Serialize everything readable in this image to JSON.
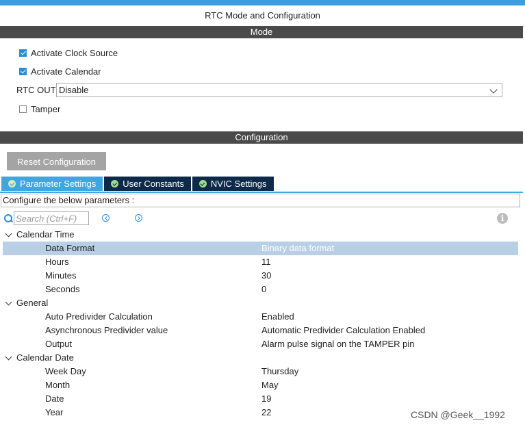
{
  "panel_title": "RTC Mode and Configuration",
  "mode": {
    "header": "Mode",
    "activate_clock_source": {
      "label": "Activate Clock Source",
      "checked": true
    },
    "activate_calendar": {
      "label": "Activate Calendar",
      "checked": true
    },
    "rtc_out": {
      "label": "RTC OUT",
      "value": "Disable"
    },
    "tamper": {
      "label": "Tamper",
      "checked": false
    }
  },
  "configuration": {
    "header": "Configuration",
    "reset_button": "Reset Configuration",
    "tabs": [
      {
        "label": "Parameter Settings",
        "active": true
      },
      {
        "label": "User Constants",
        "active": false
      },
      {
        "label": "NVIC Settings",
        "active": false
      }
    ],
    "instructions": "Configure the below parameters :",
    "search_placeholder": "Search (Ctrl+F)"
  },
  "tree": {
    "calendar_time": {
      "label": "Calendar Time",
      "params": [
        {
          "name": "Data Format",
          "value": "Binary data format"
        },
        {
          "name": "Hours",
          "value": "11"
        },
        {
          "name": "Minutes",
          "value": "30"
        },
        {
          "name": "Seconds",
          "value": "0"
        }
      ]
    },
    "general": {
      "label": "General",
      "params": [
        {
          "name": "Auto Predivider Calculation",
          "value": "Enabled"
        },
        {
          "name": "Asynchronous Predivider value",
          "value": "Automatic Predivider Calculation Enabled"
        },
        {
          "name": "Output",
          "value": "Alarm pulse signal on the TAMPER pin"
        }
      ]
    },
    "calendar_date": {
      "label": "Calendar Date",
      "params": [
        {
          "name": "Week Day",
          "value": "Thursday"
        },
        {
          "name": "Month",
          "value": "May"
        },
        {
          "name": "Date",
          "value": "19"
        },
        {
          "name": "Year",
          "value": "22"
        }
      ]
    }
  },
  "watermark": "CSDN @Geek__1992",
  "colors": {
    "accent": "#3ea6e0",
    "header_bg": "#4a4a4a",
    "tab_bg": "#0e2a4a",
    "selected_row": "#b8cfe6"
  }
}
